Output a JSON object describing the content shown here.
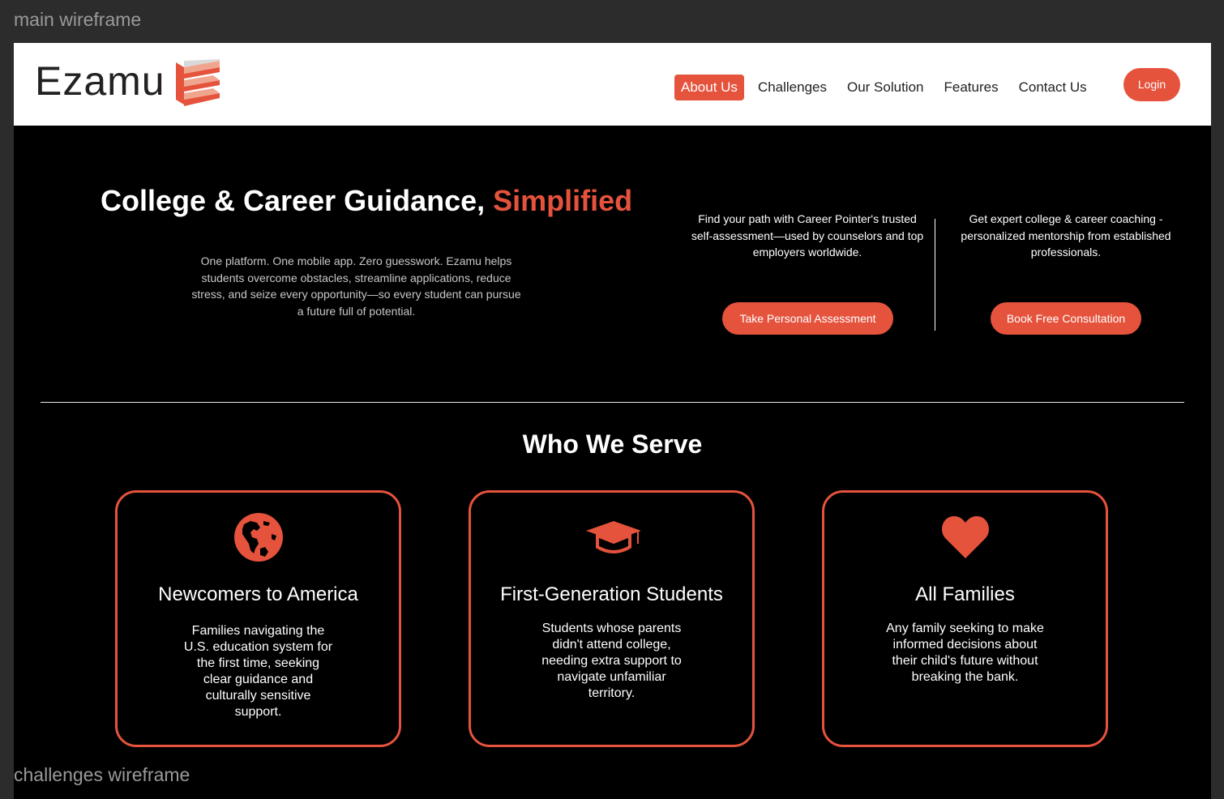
{
  "frames": {
    "top_label": "main wireframe",
    "bottom_label": "challenges wireframe"
  },
  "header": {
    "logo": "Ezamu",
    "nav": [
      {
        "label": "About Us",
        "active": true
      },
      {
        "label": "Challenges",
        "active": false
      },
      {
        "label": "Our Solution",
        "active": false
      },
      {
        "label": "Features",
        "active": false
      },
      {
        "label": "Contact Us",
        "active": false
      }
    ],
    "login": "Login"
  },
  "hero": {
    "title_main": "College & Career Guidance, ",
    "title_accent": "Simplified",
    "description": "One platform. One mobile app. Zero guesswork. Ezamu helps students overcome obstacles, streamline applications, reduce stress, and seize every opportunity—so every student can pursue a future full of potential.",
    "cta_left": {
      "text": "Find your path with Career Pointer's trusted self-assessment—used by counselors and top employers worldwide.",
      "button": "Take Personal Assessment"
    },
    "cta_right": {
      "text": "Get expert college & career coaching - personalized mentorship from established professionals.",
      "button": "Book Free Consultation"
    }
  },
  "serve": {
    "title": "Who We Serve",
    "cards": [
      {
        "icon": "globe-icon",
        "title": "Newcomers to America",
        "text": "Families navigating the U.S. education system for the first time, seeking clear guidance and culturally sensitive support."
      },
      {
        "icon": "graduation-cap-icon",
        "title": "First-Generation Students",
        "text": "Students whose parents didn't attend college, needing extra support to navigate unfamiliar territory."
      },
      {
        "icon": "heart-icon",
        "title": "All Families",
        "text": "Any family seeking to make informed decisions about their child's future without breaking the bank."
      }
    ]
  },
  "colors": {
    "accent": "#e5533d",
    "background": "#000000",
    "header_bg": "#ffffff"
  }
}
